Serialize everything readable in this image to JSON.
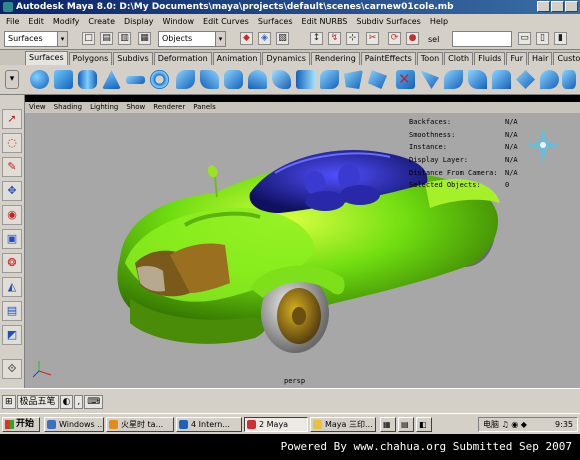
{
  "window": {
    "title": "Autodesk Maya 8.0: D:\\My Documents\\maya\\projects\\default\\scenes\\carnew01cole.mb"
  },
  "menubar": {
    "items": [
      "File",
      "Edit",
      "Modify",
      "Create",
      "Display",
      "Window",
      "Edit Curves",
      "Surfaces",
      "Edit NURBS",
      "Subdiv Surfaces",
      "Help"
    ]
  },
  "statusline": {
    "menuset": "Surfaces",
    "selection_mode": "Objects",
    "render_label": "sel"
  },
  "shelf": {
    "tabs": [
      "Surfaces",
      "Polygons",
      "Subdivs",
      "Deformation",
      "Animation",
      "Dynamics",
      "Rendering",
      "PaintEffects",
      "Toon",
      "Cloth",
      "Fluids",
      "Fur",
      "Hair",
      "Custom"
    ],
    "active_tab": "Surfaces"
  },
  "panel": {
    "menus": [
      "View",
      "Shading",
      "Lighting",
      "Show",
      "Renderer",
      "Panels"
    ]
  },
  "hud": {
    "rows": [
      {
        "label": "Backfaces:",
        "value": "N/A"
      },
      {
        "label": "Smoothness:",
        "value": "N/A"
      },
      {
        "label": "Instance:",
        "value": "N/A"
      },
      {
        "label": "Display Layer:",
        "value": "N/A"
      },
      {
        "label": "Distance From Camera:",
        "value": "N/A"
      },
      {
        "label": "Selected Objects:",
        "value": "0"
      }
    ],
    "camera": "persp"
  },
  "bottombar": {
    "ime_label": "极品五笔"
  },
  "taskbar": {
    "start_label": "开始",
    "tasks": [
      "Windows ...",
      "火星时 ta...",
      "4 Intern...",
      "2 Maya",
      "Maya 三印..."
    ],
    "active_task": "2 Maya",
    "tray_label": "电脑",
    "clock": "9:35"
  },
  "footer": {
    "text": "Powered By www.chahua.org  Submitted Sep 2007"
  }
}
